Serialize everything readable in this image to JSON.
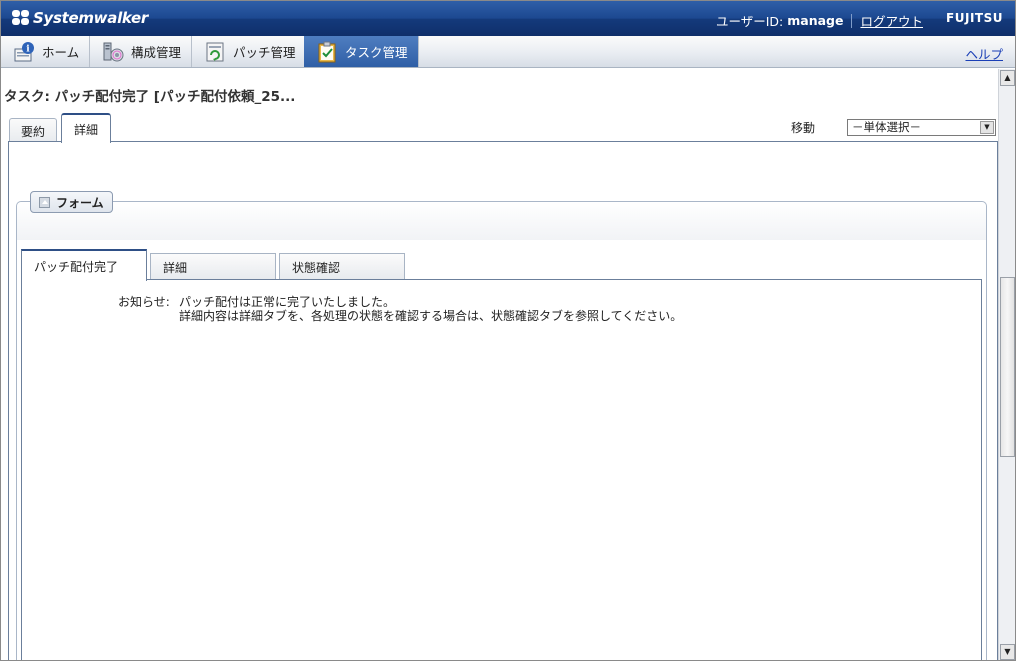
{
  "header": {
    "brand": "Systemwalker",
    "user_id_label": "ユーザーID:",
    "user_id_value": "manage",
    "logout": "ログアウト",
    "corp_logo": "FUJITSU"
  },
  "nav": {
    "items": [
      {
        "label": "ホーム",
        "icon": "home-info-icon",
        "active": false
      },
      {
        "label": "構成管理",
        "icon": "configuration-icon",
        "active": false
      },
      {
        "label": "パッチ管理",
        "icon": "patch-icon",
        "active": false
      },
      {
        "label": "タスク管理",
        "icon": "task-checklist-icon",
        "active": true
      }
    ],
    "help": "ヘルプ"
  },
  "page": {
    "task_title": "タスク: パッチ配付完了 [パッチ配付依頼_25...",
    "outer_tabs": [
      {
        "label": "要約",
        "active": false
      },
      {
        "label": "詳細",
        "active": true
      }
    ],
    "move_label": "移動",
    "move_select_value": "－単体選択－"
  },
  "form": {
    "legend": "フォーム",
    "inner_tabs": [
      {
        "label": "パッチ配付完了",
        "active": true
      },
      {
        "label": "詳細",
        "active": false
      },
      {
        "label": "状態確認",
        "active": false
      }
    ],
    "notice_label": "お知らせ:",
    "notice_lines": [
      "パッチ配付は正常に完了いたしました。",
      "詳細内容は詳細タブを、各処理の状態を確認する場合は、状態確認タブを参照してください。"
    ]
  },
  "colors": {
    "header_bg": "#1c4890",
    "nav_active_bg": "#2f5fa6",
    "help_link": "#1a3fb6"
  }
}
